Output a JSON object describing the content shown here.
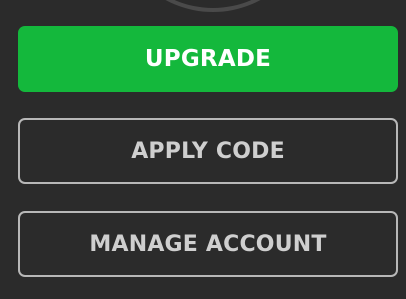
{
  "buttons": {
    "upgrade": "UPGRADE",
    "apply_code": "APPLY CODE",
    "manage_account": "MANAGE ACCOUNT"
  },
  "colors": {
    "background": "#2b2b2b",
    "upgrade_green": "#14b83c",
    "outline_border": "#b8b8b8",
    "outline_text": "#cfcfcf"
  }
}
